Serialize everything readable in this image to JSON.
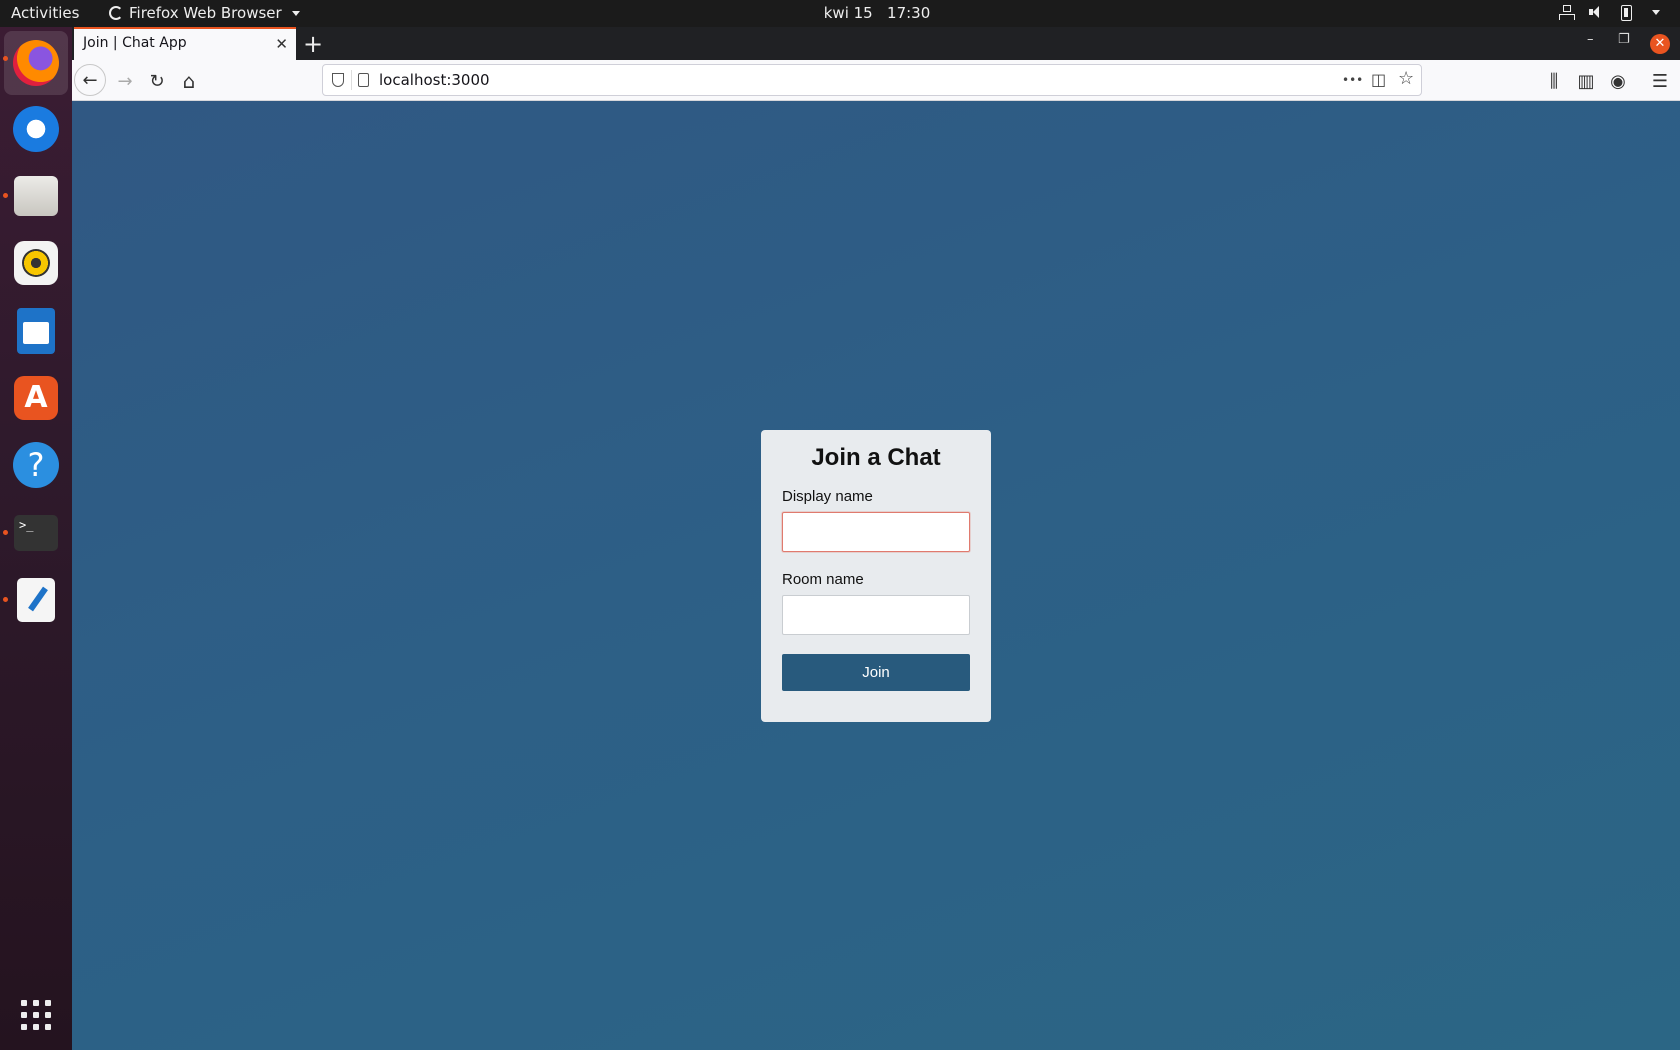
{
  "system": {
    "activities_label": "Activities",
    "app_menu_label": "Firefox Web Browser",
    "clock_day": "kwi 15",
    "clock_time": "17:30"
  },
  "dock": {
    "apps": [
      "firefox-icon",
      "thunderbird-icon",
      "files-icon",
      "rhythmbox-icon",
      "writer-icon",
      "software-store-icon",
      "help-icon",
      "terminal-icon",
      "text-editor-icon",
      "show-apps-icon"
    ],
    "store_glyph": "A",
    "help_glyph": "?",
    "terminal_glyph": ">_"
  },
  "browser": {
    "tab_title": "Join | Chat App",
    "tab_close_glyph": "✕",
    "new_tab_glyph": "+",
    "url": "localhost:3000",
    "minimize_glyph": "–",
    "restore_glyph": "❐",
    "close_glyph": "✕",
    "back_glyph": "←",
    "forward_glyph": "→",
    "reload_glyph": "↻",
    "home_glyph": "⌂",
    "more_glyph": "•••",
    "pocket_glyph": "◫",
    "star_glyph": "☆",
    "library_glyph": "⫼",
    "sidebar_glyph": "▥",
    "account_glyph": "◉",
    "menu_glyph": "☰"
  },
  "join_form": {
    "title": "Join a Chat",
    "display_name_label": "Display name",
    "display_name_value": "",
    "room_name_label": "Room name",
    "room_name_value": "",
    "join_button_label": "Join"
  },
  "colors": {
    "accent": "#e95420",
    "page_bg": "#2d5f86",
    "button_bg": "#285a7d",
    "card_bg": "#e8ebee"
  }
}
